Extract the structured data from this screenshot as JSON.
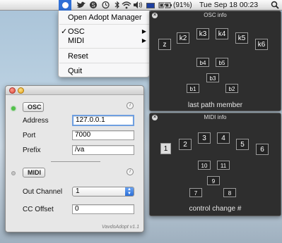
{
  "menubar": {
    "battery_text": "(91%)",
    "datetime": "Tue Sep 18  00:23"
  },
  "menu": {
    "items": [
      {
        "label": "Open Adopt Manager"
      },
      {
        "label": "OSC",
        "check": "✓",
        "arrow": "▶"
      },
      {
        "label": "MIDI",
        "arrow": "▶"
      },
      {
        "label": "Reset"
      },
      {
        "label": "Quit"
      }
    ]
  },
  "osc_info": {
    "title": "OSC info",
    "close": "×",
    "footer": "last path member",
    "boxes": [
      "z",
      "k2",
      "k3",
      "k4",
      "k5",
      "k6",
      "b4",
      "b5",
      "b3",
      "b1",
      "b2"
    ]
  },
  "midi_info": {
    "title": "MIDI info",
    "close": "×",
    "footer": "control change #",
    "boxes": [
      "1",
      "2",
      "3",
      "4",
      "5",
      "6",
      "10",
      "11",
      "9",
      "7",
      "8"
    ]
  },
  "main": {
    "osc_button": "OSC",
    "address_label": "Address",
    "address_value": "127.0.0.1",
    "port_label": "Port",
    "port_value": "7000",
    "prefix_label": "Prefix",
    "prefix_value": "/va",
    "midi_button": "MIDI",
    "channel_label": "Out Channel",
    "channel_value": "1",
    "cc_label": "CC Offset",
    "cc_value": "0",
    "info_glyph": "i",
    "version": "VavdoAdopt v1.1"
  },
  "colors": {
    "menu_highlight": "#2f6fd6",
    "hud_background": "#2e2e2e",
    "osc_led": "#52c24a"
  },
  "icons": [
    "adopt-status-icon",
    "twitter-bird-icon",
    "skype-icon",
    "time-machine-icon",
    "bluetooth-icon",
    "wifi-icon",
    "volume-icon",
    "flag-icon",
    "battery-icon",
    "spotlight-icon"
  ]
}
